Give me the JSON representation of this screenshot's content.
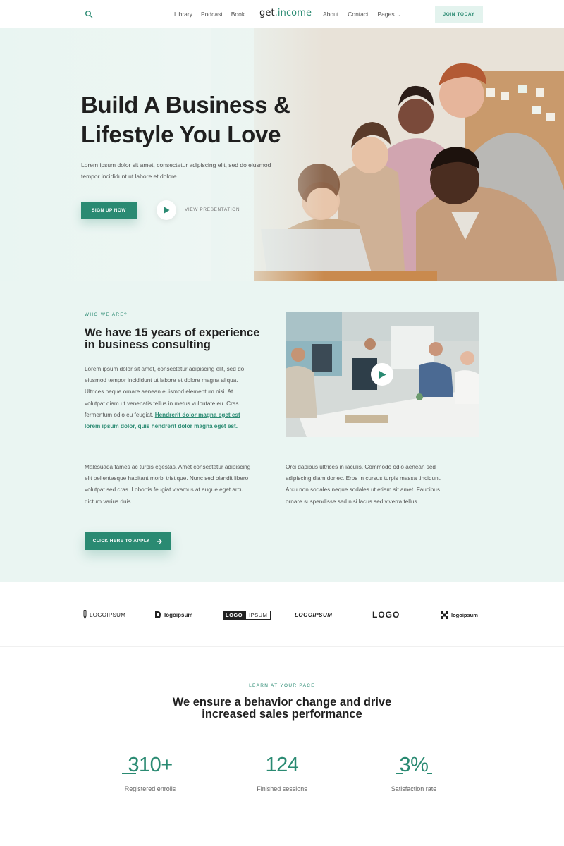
{
  "header": {
    "logo_text": "get",
    "logo_accent": ".income",
    "nav_left": [
      "Library",
      "Podcast",
      "Book"
    ],
    "nav_right": [
      "About",
      "Contact",
      "Pages"
    ],
    "join_label": "JOIN TODAY"
  },
  "hero": {
    "title_line1": "Build A Business &",
    "title_line2": "Lifestyle You Love",
    "subtitle": "Lorem ipsum dolor sit amet, consectetur adipiscing elit, sed do eiusmod tempor incididunt ut labore et dolore.",
    "cta_label": "SIGN UP NOW",
    "presentation_label": "VIEW PRESENTATION"
  },
  "about": {
    "eyebrow": "WHO WE ARE?",
    "title": "We have 15 years of experience in business consulting",
    "p1_text": "Lorem ipsum dolor sit amet, consectetur adipiscing elit, sed do eiusmod tempor incididunt ut labore et dolore magna aliqua. Ultrices neque ornare aenean euismod elementum nisi. At volutpat diam ut venenatis tellus in metus vulputate eu. Cras fermentum odio eu feugiat. ",
    "p1_link": "Hendrerit dolor magna eget est lorem ipsum dolor, quis hendrerit dolor magna eget est.",
    "p2": "Malesuada fames ac turpis egestas. Amet consectetur adipiscing elit pellentesque habitant morbi tristique. Nunc sed blandit libero volutpat sed cras. Lobortis feugiat vivamus at augue eget arcu dictum varius duis.",
    "p3": "Orci dapibus ultrices in iaculis. Commodo odio aenean sed adipiscing diam donec. Eros in cursus turpis massa tincidunt. Arcu non sodales neque sodales ut etiam sit amet. Faucibus ornare suspendisse sed nisi lacus sed viverra tellus",
    "apply_label": "CLICK HERE TO APPLY"
  },
  "logos": {
    "items": [
      "LOGOIPSUM",
      "logoipsum",
      "LOGO",
      "IPSUM",
      "LOGOIPSUM",
      "LOGO",
      "logoipsum"
    ]
  },
  "stats": {
    "eyebrow": "LEARN AT YOUR PACE",
    "title_line1": "We ensure a behavior change and drive",
    "title_line2": "increased sales performance",
    "items": [
      {
        "value": "310+",
        "label": "Registered enrolls"
      },
      {
        "value": "124",
        "label": "Finished sessions"
      },
      {
        "value": "3%",
        "label": "Satisfaction rate"
      }
    ]
  },
  "colors": {
    "accent": "#2a8a72",
    "accent_light": "#e3f3ee",
    "section_bg": "#eaf5f2"
  },
  "icons": {
    "search": "search-icon",
    "play": "play-icon",
    "arrow": "arrow-right-icon",
    "chevron": "chevron-down-icon"
  }
}
